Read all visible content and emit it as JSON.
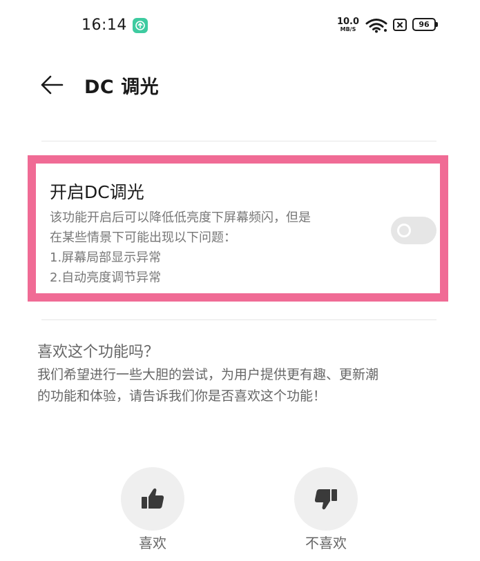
{
  "status_bar": {
    "time": "16:14",
    "net_speed_value": "10.0",
    "net_speed_unit": "MB/S",
    "battery": "96"
  },
  "header": {
    "title": "DC 调光"
  },
  "dc_setting": {
    "title": "开启DC调光",
    "description_lines": [
      "该功能开启后可以降低低亮度下屏幕频闪，但是",
      "在某些情景下可能出现以下问题：",
      "1.屏幕局部显示异常",
      "2.自动亮度调节异常"
    ],
    "enabled": false
  },
  "feedback": {
    "title": "喜欢这个功能吗？",
    "description_lines": [
      "我们希望进行一些大胆的尝试，为用户提供更有趣、更新潮",
      "的功能和体验，请告诉我们你是否喜欢这个功能！"
    ],
    "like_label": "喜欢",
    "dislike_label": "不喜欢"
  },
  "colors": {
    "highlight_border": "#f06b95",
    "toggle_off": "#e6e6e6",
    "app_icon": "#3ecba0"
  }
}
